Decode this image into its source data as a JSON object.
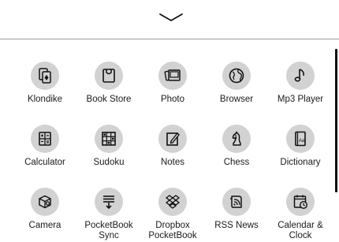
{
  "apps": [
    {
      "id": "klondike",
      "label": "Klondike",
      "icon": "cards-icon"
    },
    {
      "id": "book-store",
      "label": "Book Store",
      "icon": "store-bag-icon"
    },
    {
      "id": "photo",
      "label": "Photo",
      "icon": "photo-stack-icon"
    },
    {
      "id": "browser",
      "label": "Browser",
      "icon": "globe-icon"
    },
    {
      "id": "mp3-player",
      "label": "Mp3 Player",
      "icon": "music-note-icon"
    },
    {
      "id": "calculator",
      "label": "Calculator",
      "icon": "calculator-icon"
    },
    {
      "id": "sudoku",
      "label": "Sudoku",
      "icon": "sudoku-grid-icon"
    },
    {
      "id": "notes",
      "label": "Notes",
      "icon": "pencil-note-icon"
    },
    {
      "id": "chess",
      "label": "Chess",
      "icon": "chess-knight-icon"
    },
    {
      "id": "dictionary",
      "label": "Dictionary",
      "icon": "dictionary-book-icon"
    },
    {
      "id": "camera",
      "label": "Camera",
      "icon": "camera-cube-icon"
    },
    {
      "id": "pocketbook-sync",
      "label": "PocketBook\nSync",
      "icon": "sync-download-icon"
    },
    {
      "id": "dropbox-pocketbook",
      "label": "Dropbox\nPocketBook",
      "icon": "dropbox-icon"
    },
    {
      "id": "rss-news",
      "label": "RSS News",
      "icon": "rss-feed-icon"
    },
    {
      "id": "calendar-clock",
      "label": "Calendar &\nClock",
      "icon": "calendar-clock-icon"
    }
  ],
  "icons": {
    "dictionary_text": "Aa"
  }
}
